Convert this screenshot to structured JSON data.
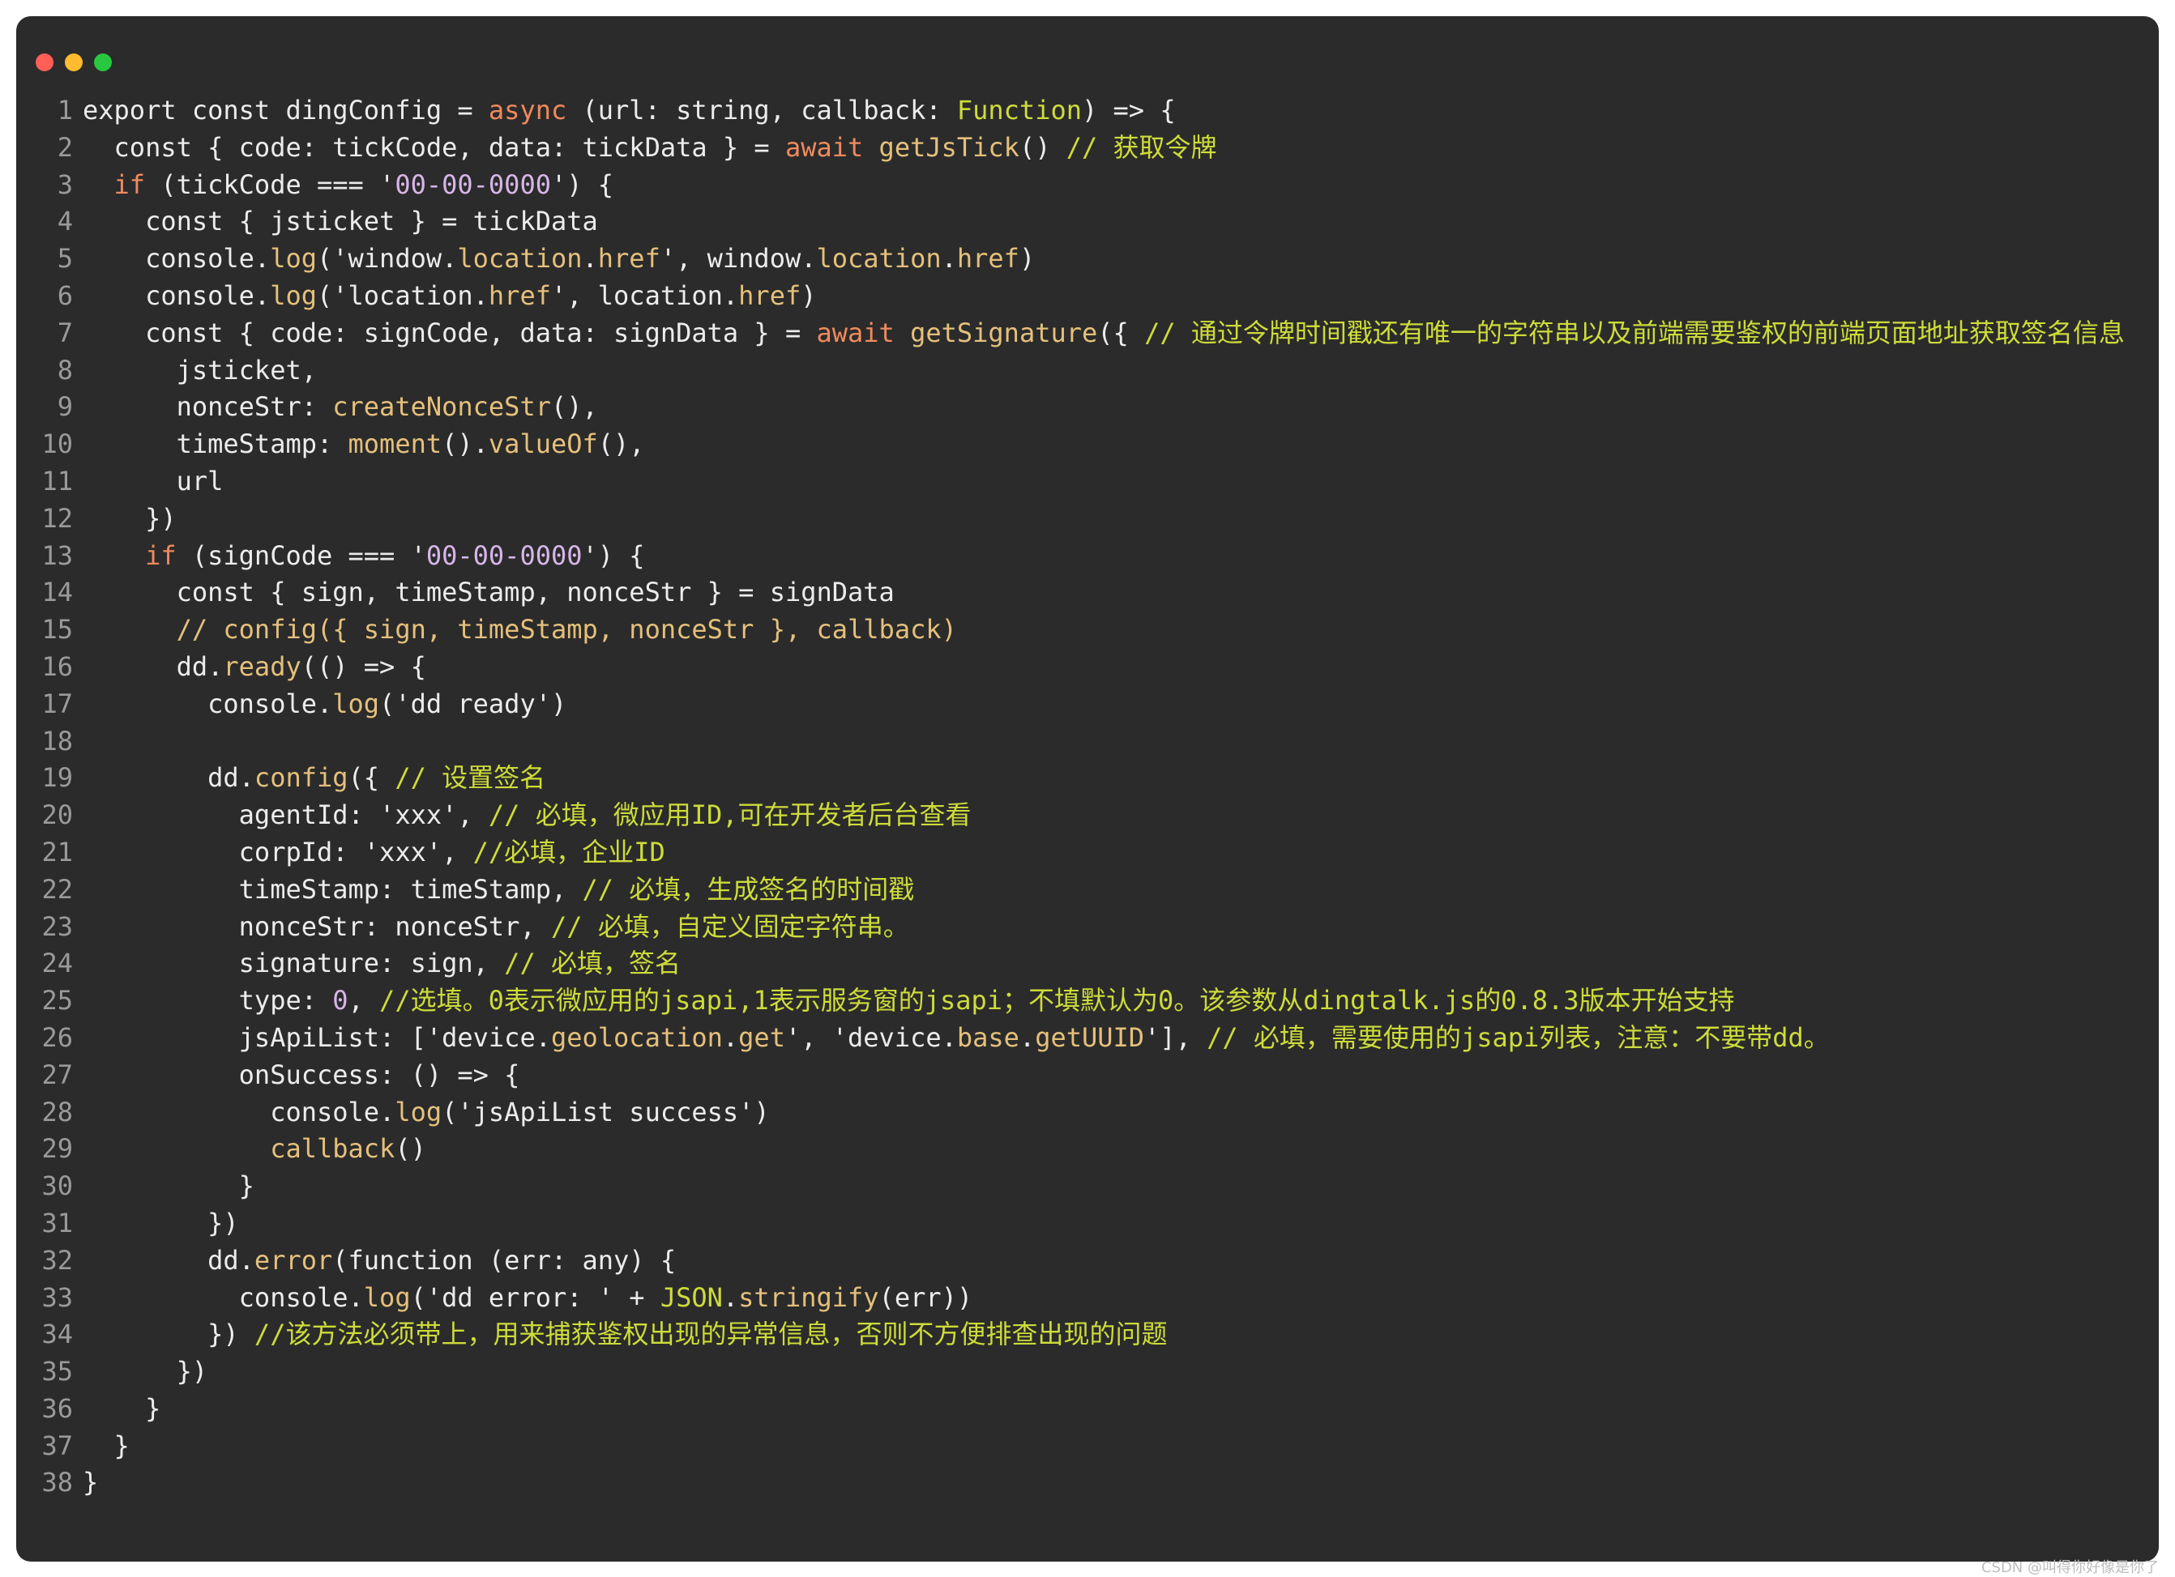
{
  "colors": {
    "background": "#2b2b2b",
    "plain": "#ececec",
    "line_number": "#9a9a9a",
    "keyword": "#f08a5d",
    "function": "#e5c07b",
    "string": "#d7b6e8",
    "comment": "#cddc39",
    "number": "#d7b6e8",
    "traffic_light_red": "#ff5f57",
    "traffic_light_yellow": "#febc2e",
    "traffic_light_green": "#28c840"
  },
  "editor": {
    "lines": [
      {
        "n": "1",
        "tokens": [
          {
            "t": "export const dingConfig = ",
            "c": "plain"
          },
          {
            "t": "async",
            "c": "keyword"
          },
          {
            "t": " (url: string, callback: ",
            "c": "plain"
          },
          {
            "t": "Function",
            "c": "comment"
          },
          {
            "t": ") => {",
            "c": "plain"
          }
        ]
      },
      {
        "n": "2",
        "tokens": [
          {
            "t": "  const { code: tickCode, data: tickData } = ",
            "c": "plain"
          },
          {
            "t": "await",
            "c": "keyword"
          },
          {
            "t": " ",
            "c": "plain"
          },
          {
            "t": "getJsTick",
            "c": "function"
          },
          {
            "t": "() ",
            "c": "plain"
          },
          {
            "t": "// 获取令牌",
            "c": "comment"
          }
        ]
      },
      {
        "n": "3",
        "tokens": [
          {
            "t": "  ",
            "c": "plain"
          },
          {
            "t": "if",
            "c": "keyword"
          },
          {
            "t": " (tickCode === '",
            "c": "plain"
          },
          {
            "t": "00-00-0000",
            "c": "string"
          },
          {
            "t": "') {",
            "c": "plain"
          }
        ]
      },
      {
        "n": "4",
        "tokens": [
          {
            "t": "    const { jsticket } = tickData",
            "c": "plain"
          }
        ]
      },
      {
        "n": "5",
        "tokens": [
          {
            "t": "    console.",
            "c": "plain"
          },
          {
            "t": "log",
            "c": "function"
          },
          {
            "t": "('window.",
            "c": "plain"
          },
          {
            "t": "location",
            "c": "function"
          },
          {
            "t": ".",
            "c": "plain"
          },
          {
            "t": "href",
            "c": "function"
          },
          {
            "t": "', window.",
            "c": "plain"
          },
          {
            "t": "location",
            "c": "function"
          },
          {
            "t": ".",
            "c": "plain"
          },
          {
            "t": "href",
            "c": "function"
          },
          {
            "t": ")",
            "c": "plain"
          }
        ]
      },
      {
        "n": "6",
        "tokens": [
          {
            "t": "    console.",
            "c": "plain"
          },
          {
            "t": "log",
            "c": "function"
          },
          {
            "t": "('location.",
            "c": "plain"
          },
          {
            "t": "href",
            "c": "function"
          },
          {
            "t": "', location.",
            "c": "plain"
          },
          {
            "t": "href",
            "c": "function"
          },
          {
            "t": ")",
            "c": "plain"
          }
        ]
      },
      {
        "n": "7",
        "tokens": [
          {
            "t": "    const { code: signCode, data: signData } = ",
            "c": "plain"
          },
          {
            "t": "await",
            "c": "keyword"
          },
          {
            "t": " ",
            "c": "plain"
          },
          {
            "t": "getSignature",
            "c": "function"
          },
          {
            "t": "({ ",
            "c": "plain"
          },
          {
            "t": "// 通过令牌时间戳还有唯一的字符串以及前端需要鉴权的前端页面地址获取签名信息",
            "c": "comment"
          }
        ]
      },
      {
        "n": "8",
        "tokens": [
          {
            "t": "      jsticket,",
            "c": "plain"
          }
        ]
      },
      {
        "n": "9",
        "tokens": [
          {
            "t": "      nonceStr: ",
            "c": "plain"
          },
          {
            "t": "createNonceStr",
            "c": "function"
          },
          {
            "t": "(),",
            "c": "plain"
          }
        ]
      },
      {
        "n": "10",
        "tokens": [
          {
            "t": "      timeStamp: ",
            "c": "plain"
          },
          {
            "t": "moment",
            "c": "function"
          },
          {
            "t": "().",
            "c": "plain"
          },
          {
            "t": "valueOf",
            "c": "function"
          },
          {
            "t": "(),",
            "c": "plain"
          }
        ]
      },
      {
        "n": "11",
        "tokens": [
          {
            "t": "      url",
            "c": "plain"
          }
        ]
      },
      {
        "n": "12",
        "tokens": [
          {
            "t": "    })",
            "c": "plain"
          }
        ]
      },
      {
        "n": "13",
        "tokens": [
          {
            "t": "    ",
            "c": "plain"
          },
          {
            "t": "if",
            "c": "keyword"
          },
          {
            "t": " (signCode === '",
            "c": "plain"
          },
          {
            "t": "00-00-0000",
            "c": "string"
          },
          {
            "t": "') {",
            "c": "plain"
          }
        ]
      },
      {
        "n": "14",
        "tokens": [
          {
            "t": "      const { sign, timeStamp, nonceStr } = signData",
            "c": "plain"
          }
        ]
      },
      {
        "n": "15",
        "tokens": [
          {
            "t": "      // config({ sign, timeStamp, nonceStr }, callback)",
            "c": "function"
          }
        ]
      },
      {
        "n": "16",
        "tokens": [
          {
            "t": "      dd.",
            "c": "plain"
          },
          {
            "t": "ready",
            "c": "function"
          },
          {
            "t": "(() => {",
            "c": "plain"
          }
        ]
      },
      {
        "n": "17",
        "tokens": [
          {
            "t": "        console.",
            "c": "plain"
          },
          {
            "t": "log",
            "c": "function"
          },
          {
            "t": "('dd ready')",
            "c": "plain"
          }
        ]
      },
      {
        "n": "18",
        "tokens": [
          {
            "t": "",
            "c": "plain"
          }
        ]
      },
      {
        "n": "19",
        "tokens": [
          {
            "t": "        dd.",
            "c": "plain"
          },
          {
            "t": "config",
            "c": "function"
          },
          {
            "t": "({ ",
            "c": "plain"
          },
          {
            "t": "// 设置签名",
            "c": "comment"
          }
        ]
      },
      {
        "n": "20",
        "tokens": [
          {
            "t": "          agentId: 'xxx', ",
            "c": "plain"
          },
          {
            "t": "// 必填，微应用ID,可在开发者后台查看",
            "c": "comment"
          }
        ]
      },
      {
        "n": "21",
        "tokens": [
          {
            "t": "          corpId: 'xxx', ",
            "c": "plain"
          },
          {
            "t": "//必填，企业ID",
            "c": "comment"
          }
        ]
      },
      {
        "n": "22",
        "tokens": [
          {
            "t": "          timeStamp: timeStamp, ",
            "c": "plain"
          },
          {
            "t": "// 必填，生成签名的时间戳",
            "c": "comment"
          }
        ]
      },
      {
        "n": "23",
        "tokens": [
          {
            "t": "          nonceStr: nonceStr, ",
            "c": "plain"
          },
          {
            "t": "// 必填，自定义固定字符串。",
            "c": "comment"
          }
        ]
      },
      {
        "n": "24",
        "tokens": [
          {
            "t": "          signature: sign, ",
            "c": "plain"
          },
          {
            "t": "// 必填，签名",
            "c": "comment"
          }
        ]
      },
      {
        "n": "25",
        "tokens": [
          {
            "t": "          type: ",
            "c": "plain"
          },
          {
            "t": "0",
            "c": "number"
          },
          {
            "t": ", ",
            "c": "plain"
          },
          {
            "t": "//选填。0表示微应用的jsapi,1表示服务窗的jsapi；不填默认为0。该参数从dingtalk.js的0.8.3版本开始支持",
            "c": "comment"
          }
        ]
      },
      {
        "n": "26",
        "tokens": [
          {
            "t": "          jsApiList: ['device.",
            "c": "plain"
          },
          {
            "t": "geolocation",
            "c": "function"
          },
          {
            "t": ".",
            "c": "plain"
          },
          {
            "t": "get",
            "c": "function"
          },
          {
            "t": "', 'device.",
            "c": "plain"
          },
          {
            "t": "base",
            "c": "function"
          },
          {
            "t": ".",
            "c": "plain"
          },
          {
            "t": "getUUID",
            "c": "function"
          },
          {
            "t": "'], ",
            "c": "plain"
          },
          {
            "t": "// 必填，需要使用的jsapi列表，注意：不要带dd。",
            "c": "comment"
          }
        ]
      },
      {
        "n": "27",
        "tokens": [
          {
            "t": "          onSuccess: () => {",
            "c": "plain"
          }
        ]
      },
      {
        "n": "28",
        "tokens": [
          {
            "t": "            console.",
            "c": "plain"
          },
          {
            "t": "log",
            "c": "function"
          },
          {
            "t": "('jsApiList success')",
            "c": "plain"
          }
        ]
      },
      {
        "n": "29",
        "tokens": [
          {
            "t": "            ",
            "c": "plain"
          },
          {
            "t": "callback",
            "c": "function"
          },
          {
            "t": "()",
            "c": "plain"
          }
        ]
      },
      {
        "n": "30",
        "tokens": [
          {
            "t": "          }",
            "c": "plain"
          }
        ]
      },
      {
        "n": "31",
        "tokens": [
          {
            "t": "        })",
            "c": "plain"
          }
        ]
      },
      {
        "n": "32",
        "tokens": [
          {
            "t": "        dd.",
            "c": "plain"
          },
          {
            "t": "error",
            "c": "function"
          },
          {
            "t": "(function (err: any) {",
            "c": "plain"
          }
        ]
      },
      {
        "n": "33",
        "tokens": [
          {
            "t": "          console.",
            "c": "plain"
          },
          {
            "t": "log",
            "c": "function"
          },
          {
            "t": "('dd error: ' + ",
            "c": "plain"
          },
          {
            "t": "JSON",
            "c": "comment"
          },
          {
            "t": ".",
            "c": "plain"
          },
          {
            "t": "stringify",
            "c": "function"
          },
          {
            "t": "(err))",
            "c": "plain"
          }
        ]
      },
      {
        "n": "34",
        "tokens": [
          {
            "t": "        }) ",
            "c": "plain"
          },
          {
            "t": "//该方法必须带上，用来捕获鉴权出现的异常信息，否则不方便排查出现的问题",
            "c": "comment"
          }
        ]
      },
      {
        "n": "35",
        "tokens": [
          {
            "t": "      })",
            "c": "plain"
          }
        ]
      },
      {
        "n": "36",
        "tokens": [
          {
            "t": "    }",
            "c": "plain"
          }
        ]
      },
      {
        "n": "37",
        "tokens": [
          {
            "t": "  }",
            "c": "plain"
          }
        ]
      },
      {
        "n": "38",
        "tokens": [
          {
            "t": "}",
            "c": "plain"
          }
        ]
      }
    ]
  },
  "footer": {
    "watermark": "CSDN @叫得你好像是你了"
  }
}
